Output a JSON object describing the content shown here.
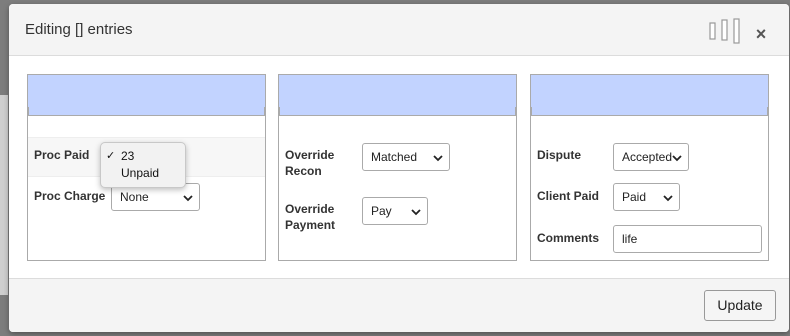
{
  "modal": {
    "title": "Editing [] entries",
    "close_symbol": "×",
    "columns_icon": "columns-icon"
  },
  "panel1": {
    "proc_paid_label": "Proc Paid",
    "proc_charge_label": "Proc Charge",
    "proc_charge_value": "None",
    "proc_paid_dropdown": {
      "options": [
        "23",
        "Unpaid"
      ],
      "selected": "23",
      "check": "✓"
    }
  },
  "panel2": {
    "override_recon_label": "Override Recon",
    "override_recon_value": "Matched",
    "override_payment_label": "Override Payment",
    "override_payment_value": "Pay"
  },
  "panel3": {
    "dispute_label": "Dispute",
    "dispute_value": "Accepted",
    "client_paid_label": "Client Paid",
    "client_paid_value": "Paid",
    "comments_label": "Comments",
    "comments_value": "life"
  },
  "footer": {
    "update_label": "Update"
  },
  "colors": {
    "panel_header": "#c2d3ff",
    "backdrop": "#7d7d7d"
  }
}
